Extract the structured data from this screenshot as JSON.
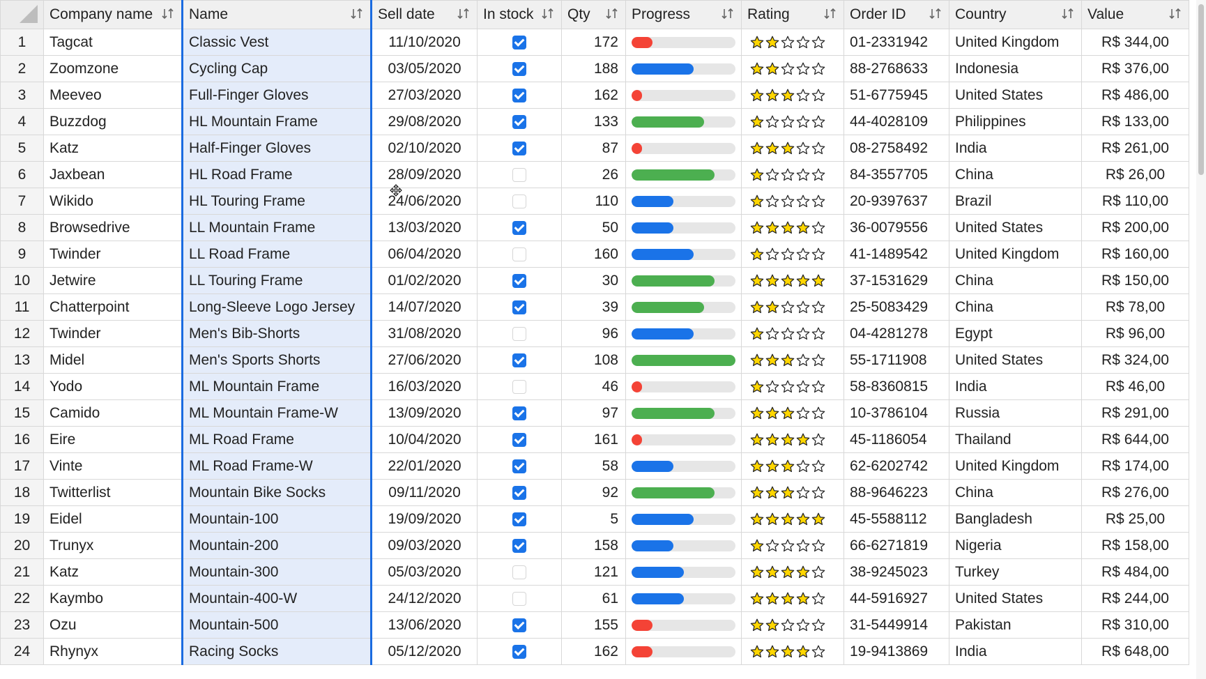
{
  "columns": [
    {
      "key": "company",
      "label": "Company name"
    },
    {
      "key": "name",
      "label": "Name"
    },
    {
      "key": "date",
      "label": "Sell date"
    },
    {
      "key": "stock",
      "label": "In stock"
    },
    {
      "key": "qty",
      "label": "Qty"
    },
    {
      "key": "progress",
      "label": "Progress"
    },
    {
      "key": "rating",
      "label": "Rating"
    },
    {
      "key": "order",
      "label": "Order ID"
    },
    {
      "key": "country",
      "label": "Country"
    },
    {
      "key": "value",
      "label": "Value"
    }
  ],
  "colors": {
    "red": "#f44336",
    "blue": "#1a73e8",
    "green": "#4caf50",
    "star": "#ffd600",
    "check": "#1a73e8",
    "selected_col": "#e4ecfa",
    "selected_border": "#1a6be0"
  },
  "rows": [
    {
      "n": "1",
      "company": "Tagcat",
      "name": "Classic Vest",
      "date": "11/10/2020",
      "stock": true,
      "qty": "172",
      "progress": 0.2,
      "pcolor": "red",
      "rating": 2,
      "order": "01-2331942",
      "country": "United Kingdom",
      "value": "R$ 344,00"
    },
    {
      "n": "2",
      "company": "Zoomzone",
      "name": "Cycling Cap",
      "date": "03/05/2020",
      "stock": true,
      "qty": "188",
      "progress": 0.6,
      "pcolor": "blue",
      "rating": 2,
      "order": "88-2768633",
      "country": "Indonesia",
      "value": "R$ 376,00"
    },
    {
      "n": "3",
      "company": "Meeveo",
      "name": "Full-Finger Gloves",
      "date": "27/03/2020",
      "stock": true,
      "qty": "162",
      "progress": 0.1,
      "pcolor": "red",
      "rating": 3,
      "order": "51-6775945",
      "country": "United States",
      "value": "R$ 486,00"
    },
    {
      "n": "4",
      "company": "Buzzdog",
      "name": "HL Mountain Frame",
      "date": "29/08/2020",
      "stock": true,
      "qty": "133",
      "progress": 0.7,
      "pcolor": "green",
      "rating": 1,
      "order": "44-4028109",
      "country": "Philippines",
      "value": "R$ 133,00"
    },
    {
      "n": "5",
      "company": "Katz",
      "name": "Half-Finger Gloves",
      "date": "02/10/2020",
      "stock": true,
      "qty": "87",
      "progress": 0.1,
      "pcolor": "red",
      "rating": 3,
      "order": "08-2758492",
      "country": "India",
      "value": "R$ 261,00"
    },
    {
      "n": "6",
      "company": "Jaxbean",
      "name": "HL Road Frame",
      "date": "28/09/2020",
      "stock": false,
      "qty": "26",
      "progress": 0.8,
      "pcolor": "green",
      "rating": 1,
      "order": "84-3557705",
      "country": "China",
      "value": "R$ 26,00"
    },
    {
      "n": "7",
      "company": "Wikido",
      "name": "HL Touring Frame",
      "date": "24/06/2020",
      "stock": false,
      "qty": "110",
      "progress": 0.4,
      "pcolor": "blue",
      "rating": 1,
      "order": "20-9397637",
      "country": "Brazil",
      "value": "R$ 110,00"
    },
    {
      "n": "8",
      "company": "Browsedrive",
      "name": "LL Mountain Frame",
      "date": "13/03/2020",
      "stock": true,
      "qty": "50",
      "progress": 0.4,
      "pcolor": "blue",
      "rating": 4,
      "order": "36-0079556",
      "country": "United States",
      "value": "R$ 200,00"
    },
    {
      "n": "9",
      "company": "Twinder",
      "name": "LL Road Frame",
      "date": "06/04/2020",
      "stock": false,
      "qty": "160",
      "progress": 0.6,
      "pcolor": "blue",
      "rating": 1,
      "order": "41-1489542",
      "country": "United Kingdom",
      "value": "R$ 160,00"
    },
    {
      "n": "10",
      "company": "Jetwire",
      "name": "LL Touring Frame",
      "date": "01/02/2020",
      "stock": true,
      "qty": "30",
      "progress": 0.8,
      "pcolor": "green",
      "rating": 5,
      "order": "37-1531629",
      "country": "China",
      "value": "R$ 150,00"
    },
    {
      "n": "11",
      "company": "Chatterpoint",
      "name": "Long-Sleeve Logo Jersey",
      "date": "14/07/2020",
      "stock": true,
      "qty": "39",
      "progress": 0.7,
      "pcolor": "green",
      "rating": 2,
      "order": "25-5083429",
      "country": "China",
      "value": "R$ 78,00"
    },
    {
      "n": "12",
      "company": "Twinder",
      "name": "Men's Bib-Shorts",
      "date": "31/08/2020",
      "stock": false,
      "qty": "96",
      "progress": 0.6,
      "pcolor": "blue",
      "rating": 1,
      "order": "04-4281278",
      "country": "Egypt",
      "value": "R$ 96,00"
    },
    {
      "n": "13",
      "company": "Midel",
      "name": "Men's Sports Shorts",
      "date": "27/06/2020",
      "stock": true,
      "qty": "108",
      "progress": 1.0,
      "pcolor": "green",
      "rating": 3,
      "order": "55-1711908",
      "country": "United States",
      "value": "R$ 324,00"
    },
    {
      "n": "14",
      "company": "Yodo",
      "name": "ML Mountain Frame",
      "date": "16/03/2020",
      "stock": false,
      "qty": "46",
      "progress": 0.1,
      "pcolor": "red",
      "rating": 1,
      "order": "58-8360815",
      "country": "India",
      "value": "R$ 46,00"
    },
    {
      "n": "15",
      "company": "Camido",
      "name": "ML Mountain Frame-W",
      "date": "13/09/2020",
      "stock": true,
      "qty": "97",
      "progress": 0.8,
      "pcolor": "green",
      "rating": 3,
      "order": "10-3786104",
      "country": "Russia",
      "value": "R$ 291,00"
    },
    {
      "n": "16",
      "company": "Eire",
      "name": "ML Road Frame",
      "date": "10/04/2020",
      "stock": true,
      "qty": "161",
      "progress": 0.1,
      "pcolor": "red",
      "rating": 4,
      "order": "45-1186054",
      "country": "Thailand",
      "value": "R$ 644,00"
    },
    {
      "n": "17",
      "company": "Vinte",
      "name": "ML Road Frame-W",
      "date": "22/01/2020",
      "stock": true,
      "qty": "58",
      "progress": 0.4,
      "pcolor": "blue",
      "rating": 3,
      "order": "62-6202742",
      "country": "United Kingdom",
      "value": "R$ 174,00"
    },
    {
      "n": "18",
      "company": "Twitterlist",
      "name": "Mountain Bike Socks",
      "date": "09/11/2020",
      "stock": true,
      "qty": "92",
      "progress": 0.8,
      "pcolor": "green",
      "rating": 3,
      "order": "88-9646223",
      "country": "China",
      "value": "R$ 276,00"
    },
    {
      "n": "19",
      "company": "Eidel",
      "name": "Mountain-100",
      "date": "19/09/2020",
      "stock": true,
      "qty": "5",
      "progress": 0.6,
      "pcolor": "blue",
      "rating": 5,
      "order": "45-5588112",
      "country": "Bangladesh",
      "value": "R$ 25,00"
    },
    {
      "n": "20",
      "company": "Trunyx",
      "name": "Mountain-200",
      "date": "09/03/2020",
      "stock": true,
      "qty": "158",
      "progress": 0.4,
      "pcolor": "blue",
      "rating": 1,
      "order": "66-6271819",
      "country": "Nigeria",
      "value": "R$ 158,00"
    },
    {
      "n": "21",
      "company": "Katz",
      "name": "Mountain-300",
      "date": "05/03/2020",
      "stock": false,
      "qty": "121",
      "progress": 0.5,
      "pcolor": "blue",
      "rating": 4,
      "order": "38-9245023",
      "country": "Turkey",
      "value": "R$ 484,00"
    },
    {
      "n": "22",
      "company": "Kaymbo",
      "name": "Mountain-400-W",
      "date": "24/12/2020",
      "stock": false,
      "qty": "61",
      "progress": 0.5,
      "pcolor": "blue",
      "rating": 4,
      "order": "44-5916927",
      "country": "United States",
      "value": "R$ 244,00"
    },
    {
      "n": "23",
      "company": "Ozu",
      "name": "Mountain-500",
      "date": "13/06/2020",
      "stock": true,
      "qty": "155",
      "progress": 0.2,
      "pcolor": "red",
      "rating": 2,
      "order": "31-5449914",
      "country": "Pakistan",
      "value": "R$ 310,00"
    },
    {
      "n": "24",
      "company": "Rhynyx",
      "name": "Racing Socks",
      "date": "05/12/2020",
      "stock": true,
      "qty": "162",
      "progress": 0.2,
      "pcolor": "red",
      "rating": 4,
      "order": "19-9413869",
      "country": "India",
      "value": "R$ 648,00"
    }
  ]
}
